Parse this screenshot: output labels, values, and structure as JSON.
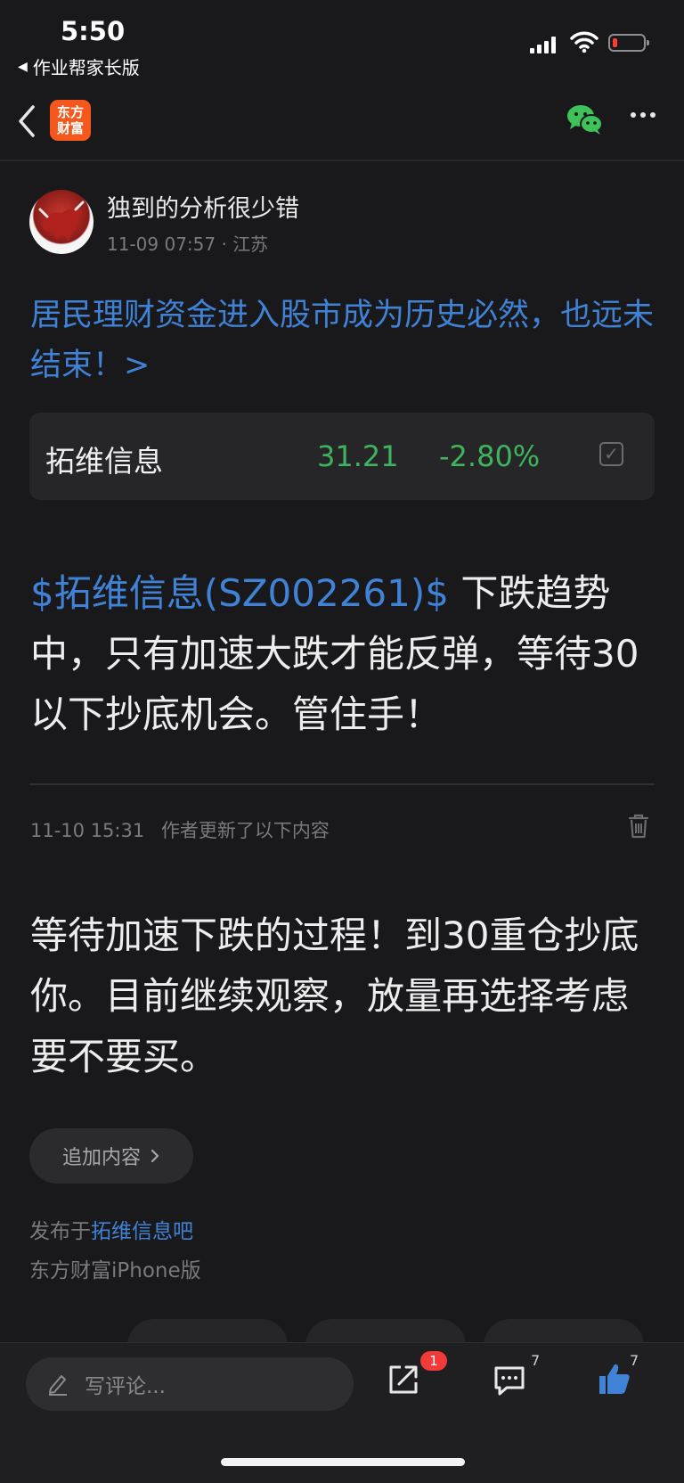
{
  "status_bar": {
    "time": "5:50",
    "back_app": "作业帮家长版",
    "battery_color": "#ff3b30"
  },
  "nav": {
    "logo_line1": "东方",
    "logo_line2": "财富",
    "logo_color": "#f5571d",
    "wechat_color": "#3fc25a",
    "icons": [
      "back-chevron-icon",
      "wechat-icon",
      "more-icon"
    ]
  },
  "post": {
    "author": "独到的分析很少错",
    "date": "11-09 07:57",
    "location": "江苏",
    "title": "居民理财资金进入股市成为历史必然，也远未结束！>",
    "link_color": "#3f82d6"
  },
  "stock": {
    "name": "拓维信息",
    "price": "31.21",
    "change": "-2.80%",
    "color": "#3fb45e"
  },
  "body": {
    "tag": "$拓维信息(SZ002261)$",
    "text": "  下跌趋势中，只有加速大跌才能反弹，等待30以下抄底机会。管住手！"
  },
  "update": {
    "date": "11-10 15:31",
    "label": "作者更新了以下内容",
    "text": "等待加速下跌的过程！到30重仓抄底你。目前继续观察，放量再选择考虑要不要买。"
  },
  "append_button": "追加内容",
  "footer": {
    "published_prefix": "发布于",
    "forum": "拓维信息吧",
    "client": "东方财富iPhone版"
  },
  "bottom_bar": {
    "comment_placeholder": "写评论...",
    "share_badge": "1",
    "comment_count": "7",
    "like_count": "7",
    "like_color": "#3f82d6"
  }
}
